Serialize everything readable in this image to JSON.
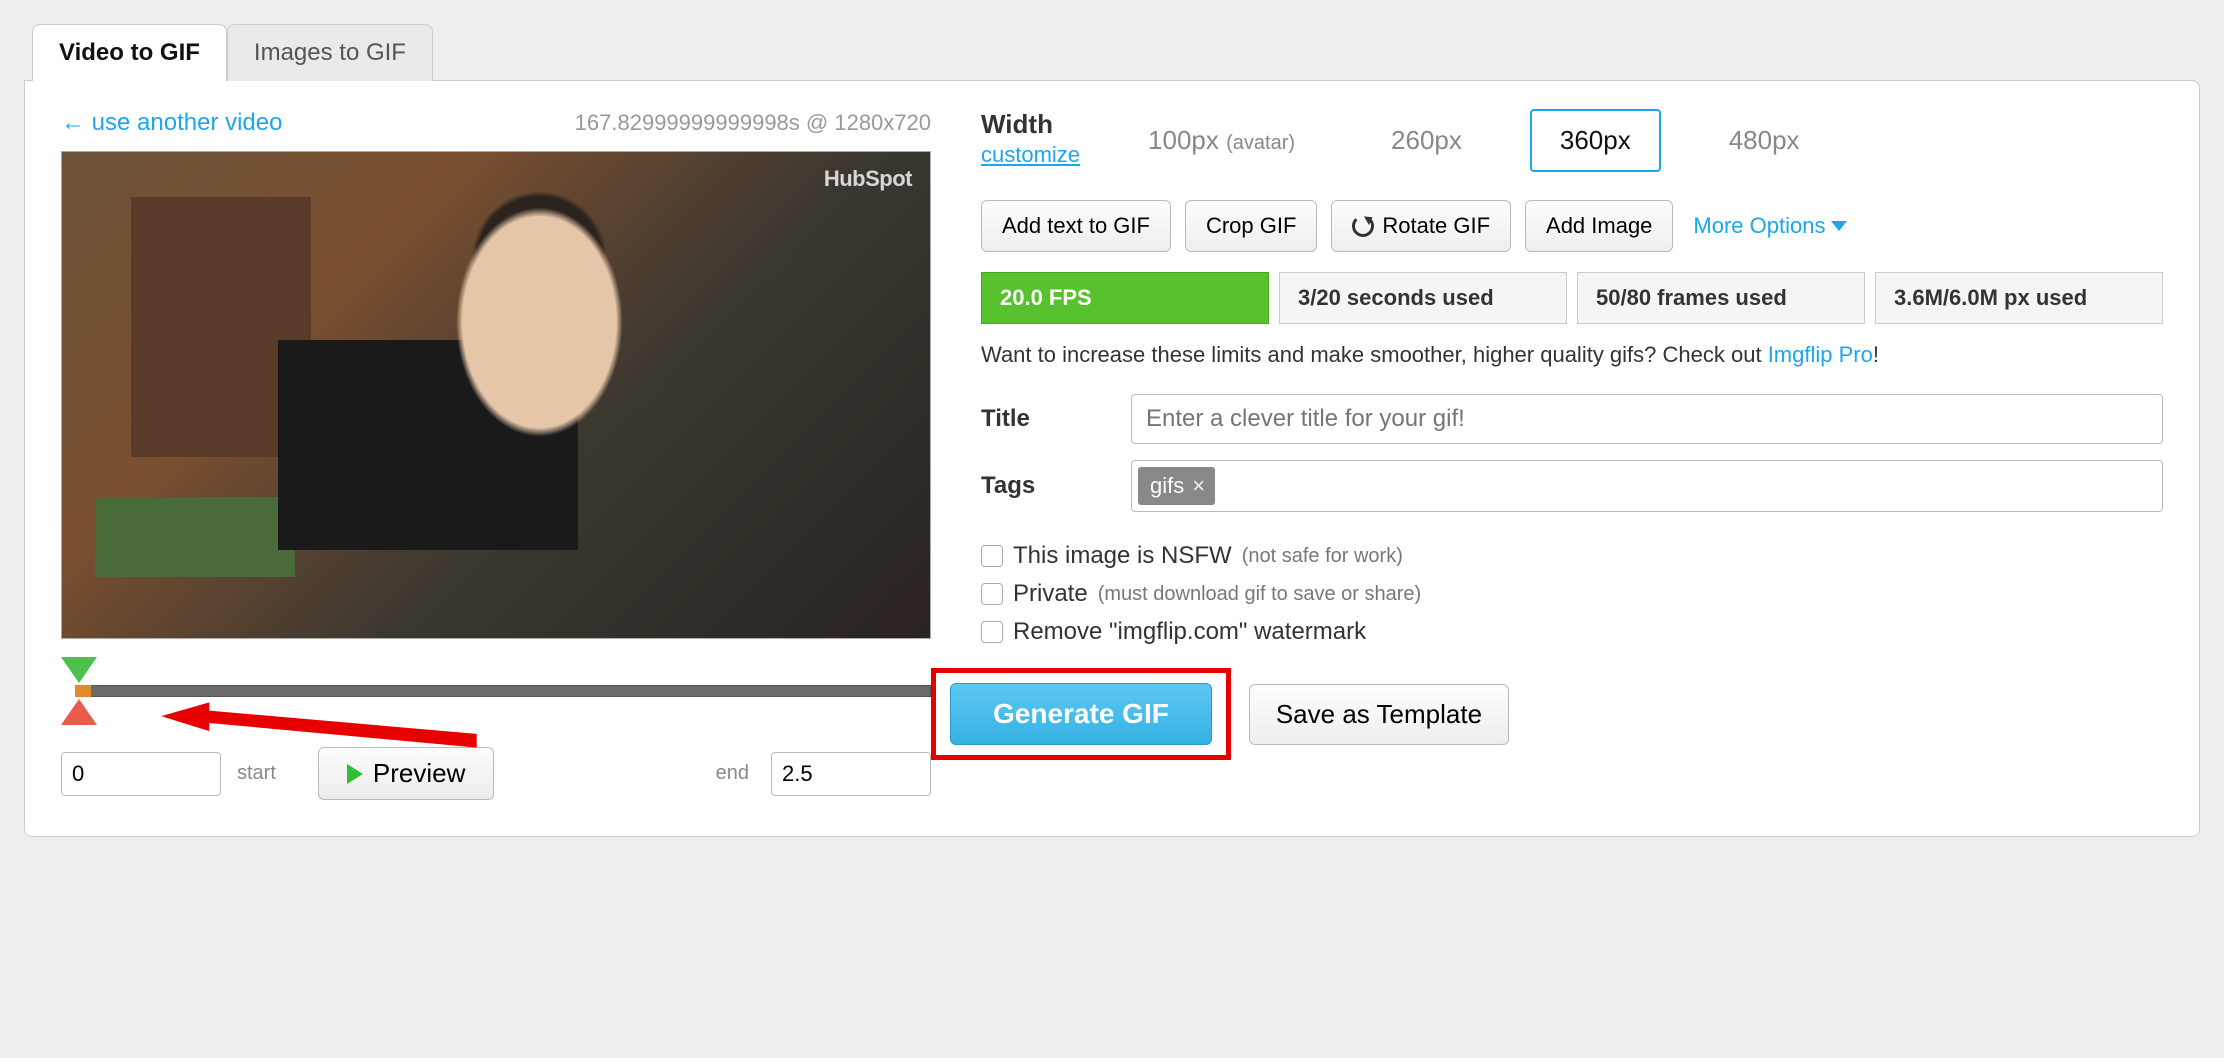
{
  "tabs": {
    "video": "Video to GIF",
    "images": "Images to GIF"
  },
  "top": {
    "use_another": "← use another video",
    "meta": "167.82999999999998s @ 1280x720"
  },
  "watermark": "HubSpot",
  "slider": {
    "start_value": "0",
    "start_label": "start",
    "end_label": "end",
    "end_value": "2.5",
    "preview": "Preview"
  },
  "width": {
    "label": "Width",
    "customize": "customize",
    "options": [
      {
        "label": "100px",
        "suffix": "(avatar)",
        "selected": false
      },
      {
        "label": "260px",
        "suffix": "",
        "selected": false
      },
      {
        "label": "360px",
        "suffix": "",
        "selected": true
      },
      {
        "label": "480px",
        "suffix": "",
        "selected": false
      }
    ]
  },
  "toolbar": {
    "add_text": "Add text to GIF",
    "crop": "Crop GIF",
    "rotate": "Rotate GIF",
    "add_image": "Add Image",
    "more": "More Options"
  },
  "stats": {
    "fps": "20.0 FPS",
    "seconds": "3/20 seconds used",
    "frames": "50/80 frames used",
    "px": "3.6M/6.0M px used"
  },
  "limits": {
    "text": "Want to increase these limits and make smoother, higher quality gifs? Check out ",
    "link": "Imgflip Pro",
    "after": "!"
  },
  "fields": {
    "title_label": "Title",
    "title_placeholder": "Enter a clever title for your gif!",
    "tags_label": "Tags",
    "tag_value": "gifs"
  },
  "checks": {
    "nsfw": "This image is NSFW",
    "nsfw_paren": "(not safe for work)",
    "private": "Private",
    "private_paren": "(must download gif to save or share)",
    "watermark": "Remove \"imgflip.com\" watermark"
  },
  "actions": {
    "generate": "Generate GIF",
    "save_template": "Save as Template"
  }
}
